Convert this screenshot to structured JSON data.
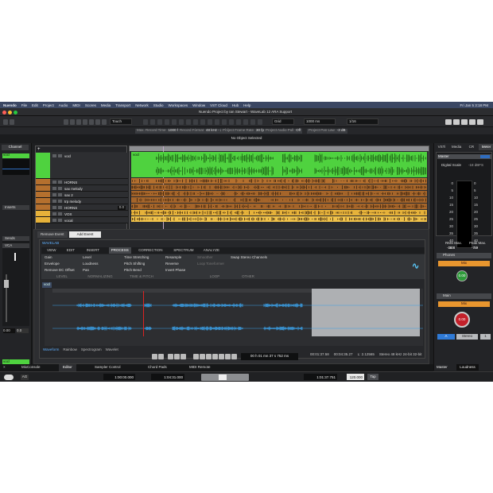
{
  "colors": {
    "accent_green": "#4fd23f",
    "horns": "#b5702e",
    "vox": "#e6b23a",
    "waveform_blue": "#3aa0e8",
    "menubar": "#3b4763",
    "record_red": "#c3202a"
  },
  "menubar": {
    "items": [
      "Nuendo",
      "File",
      "Edit",
      "Project",
      "Audio",
      "MIDI",
      "Scores",
      "Media",
      "Transport",
      "Network",
      "Studio",
      "Workspaces",
      "Window",
      "VST Cloud",
      "Hub",
      "Help"
    ],
    "clock": "Fri Jan 5 3:18 PM"
  },
  "titlebar": {
    "title": "Nuendo Project by Ian Stewart - WaveLab 12 ARA Support"
  },
  "toolbar": {
    "automation_mode": "Touch",
    "snap_type": "Grid",
    "grid_value": "1000 ms",
    "quantize": "1/16"
  },
  "infoline": [
    {
      "label": "Max. Record Time",
      "value": "1000 hours 00 mins"
    },
    {
      "label": "Record Format",
      "value": "48 kHz - 24 bit"
    },
    {
      "label": "Project Frame Rate",
      "value": "30 fps"
    },
    {
      "label": "Project Audio Pull",
      "value": "Off"
    },
    {
      "label": "Project Pan Law",
      "value": "-3 dB"
    }
  ],
  "status": "No Object Selected",
  "inspector": {
    "tab": "Channel",
    "track": "vocl",
    "sections": [
      "Inserts",
      "Sends",
      "VCA"
    ],
    "fader_values": [
      "0.00",
      "0.0"
    ],
    "bottom_track": "vocl"
  },
  "tracks": [
    {
      "name": "vocl",
      "color": "#4fd23f"
    },
    {
      "name": "HORNS",
      "color": "#b5702e",
      "folder": true
    },
    {
      "name": "sax melody",
      "color": "#b5702e"
    },
    {
      "name": "sax 2",
      "color": "#b5702e"
    },
    {
      "name": "trp melody",
      "color": "#b5702e"
    },
    {
      "name": "HORNS",
      "color": "#b5702e",
      "value": "0.0"
    },
    {
      "name": "VOX",
      "color": "#e6b23a",
      "folder": true
    },
    {
      "name": "vocal",
      "color": "#e6b23a"
    }
  ],
  "arrange": {
    "clip_label": "vocl"
  },
  "lower": {
    "event_tabs": [
      "Remove Event",
      "Add Event"
    ],
    "wavelab_label": "WAVELAB",
    "tabs": [
      "VIEW",
      "EDIT",
      "INSERT",
      "PROCESS",
      "CORRECTION",
      "SPECTRUM",
      "ANALYZE"
    ],
    "active_tab": "PROCESS",
    "groups": [
      {
        "label": "LEVEL",
        "items": [
          "Gain",
          "Envelope",
          "Remove DC Offset"
        ]
      },
      {
        "label": "NORMALIZING",
        "items": [
          "Level",
          "Loudness",
          "Pan"
        ]
      },
      {
        "label": "TIME & PITCH",
        "items": [
          "Time Stretching",
          "Pitch Shifting",
          "Pitch Bend"
        ]
      },
      {
        "label": "",
        "items": [
          "Resample",
          "Reverse",
          "Invert Phase"
        ]
      },
      {
        "label": "LOOP",
        "items": [
          "Smoother",
          "Loop Toneformer"
        ]
      },
      {
        "label": "OTHER",
        "items": [
          "Swap Stereo Channels"
        ]
      }
    ],
    "clip_name": "vocl",
    "view_modes": [
      "Waveform",
      "Rainbow",
      "Spectrogram",
      "Wavelet"
    ],
    "active_view": "Waveform",
    "status_values": [
      "00:01:37.58",
      "00:04:35.27",
      "L: 2.12565",
      "Stereo 48 kHz 24-bit 32-bit"
    ],
    "time_display": "00 h 01 mn 37 s 752 ms"
  },
  "right": {
    "tabs": [
      "VSTi",
      "Media",
      "CR",
      "Meter"
    ],
    "active_tab": "Meter",
    "master": "Master",
    "scale_label": "Digital Scale",
    "scale_value": "-18 dBFS",
    "meter_scale": [
      "0",
      "5",
      "10",
      "15",
      "20",
      "25",
      "30",
      "35",
      "40",
      "50"
    ],
    "rms_label": "RMS Max.",
    "rms_value": "-18.8",
    "peak_label": "Peak Max.",
    "peak_value": "-7.9",
    "phones": "Phones",
    "main": "Main",
    "mix": "Mix",
    "phones_knob": "0.00",
    "main_knob": "0.00",
    "buttons": [
      "A",
      "Stereo",
      "1"
    ],
    "bottom_tabs": [
      "Master",
      "Loudness"
    ]
  },
  "bottomtabs": [
    "MixConsole",
    "Editor",
    "Sampler Control",
    "Chord Pads",
    "MIDI Remote"
  ],
  "active_bottom_tab": "Editor",
  "transport": {
    "ag": "AG",
    "left_locator": "1:00:00.000",
    "right_locator": "1:04:31.000",
    "position": "1:01:37.751",
    "tempo": "120.000",
    "tempo_mode": "Tap"
  }
}
